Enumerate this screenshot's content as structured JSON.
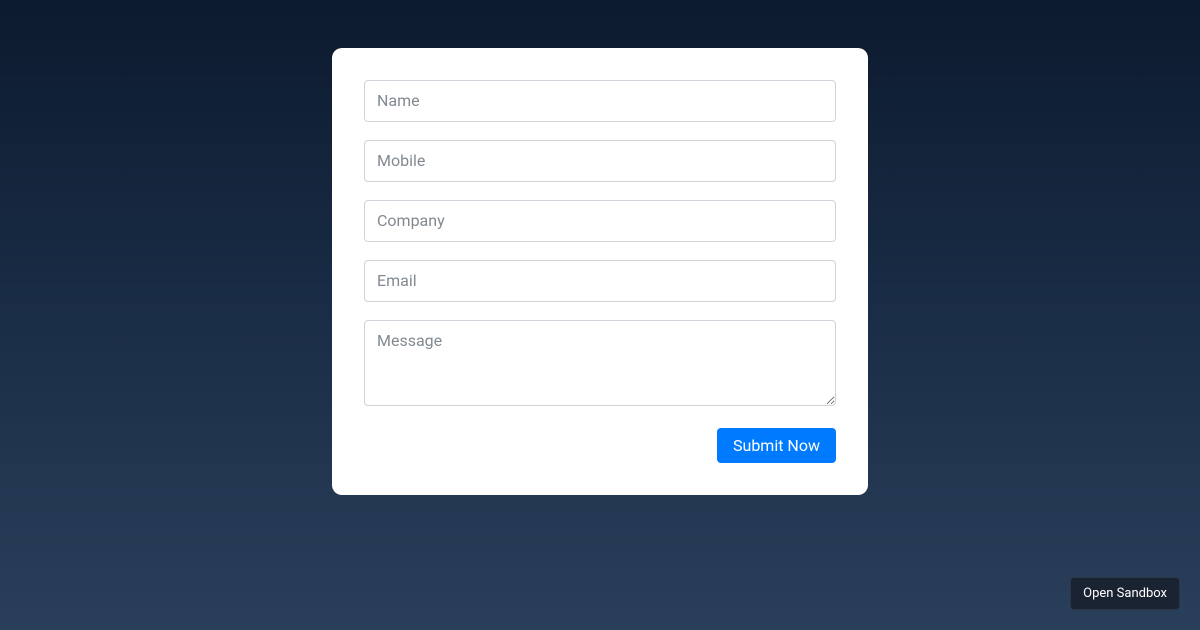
{
  "form": {
    "fields": {
      "name": {
        "placeholder": "Name",
        "value": ""
      },
      "mobile": {
        "placeholder": "Mobile",
        "value": ""
      },
      "company": {
        "placeholder": "Company",
        "value": ""
      },
      "email": {
        "placeholder": "Email",
        "value": ""
      },
      "message": {
        "placeholder": "Message",
        "value": ""
      }
    },
    "submit_label": "Submit Now"
  },
  "sandbox": {
    "open_label": "Open Sandbox"
  }
}
